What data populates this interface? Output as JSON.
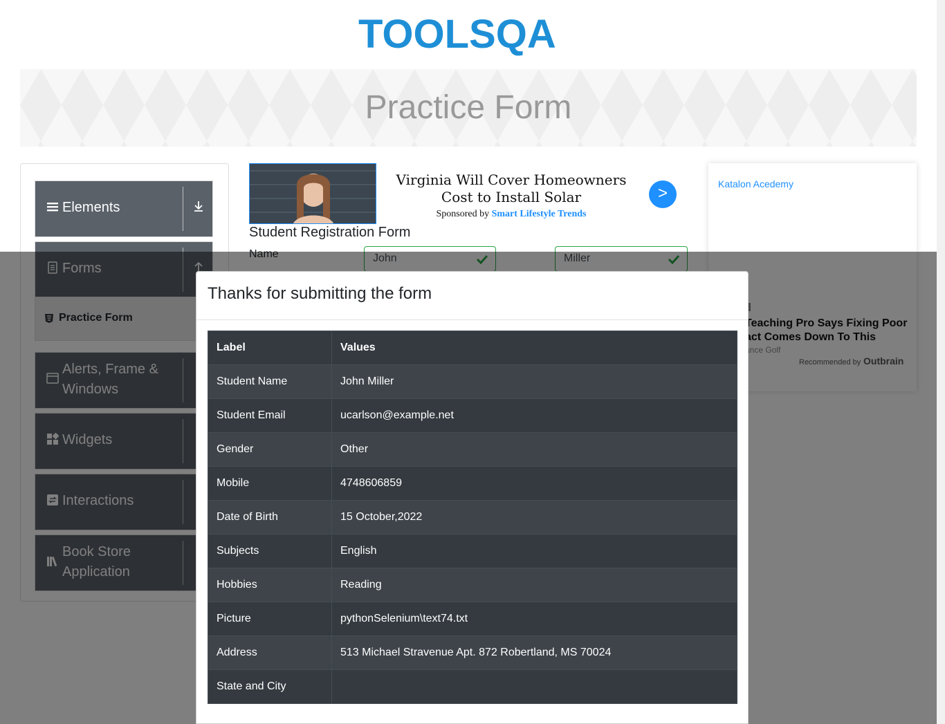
{
  "header": {
    "logo_text": "TOOLSQA"
  },
  "banner": {
    "title": "Practice Form"
  },
  "sidebar": {
    "groups": [
      {
        "label": "Elements",
        "icon": "list-icon"
      },
      {
        "label": "Forms",
        "icon": "document-icon"
      },
      {
        "label": "Alerts, Frame & Windows",
        "icon": "window-icon"
      },
      {
        "label": "Widgets",
        "icon": "widgets-icon"
      },
      {
        "label": "Interactions",
        "icon": "interactions-icon"
      },
      {
        "label": "Book Store Application",
        "icon": "books-icon"
      }
    ],
    "active_item": {
      "label": "Practice Form",
      "icon": "html5-icon"
    }
  },
  "ad": {
    "headline": "Virginia Will Cover Homeowners Cost to Install Solar",
    "sponsor_prefix": "Sponsored by",
    "sponsor_name": "Smart Lifestyle Trends",
    "go_label": ">"
  },
  "form": {
    "title": "Student Registration Form",
    "name_label": "Name",
    "first_name_value": "John",
    "last_name_value": "Miller"
  },
  "right_widget": {
    "link": "Katalon Acedemy",
    "badge": "d",
    "headline": "Teaching Pro Says Fixing Poor ...act Comes Down To This",
    "headline_line1": "Teaching Pro Says Fixing Poor",
    "headline_line2": "act Comes Down To This",
    "source": "ance Golf",
    "recommended": "Recommended by",
    "brand": "Outbrain"
  },
  "modal": {
    "title": "Thanks for submitting the form",
    "columns": [
      "Label",
      "Values"
    ],
    "rows": [
      {
        "label": "Student Name",
        "value": "John Miller"
      },
      {
        "label": "Student Email",
        "value": "ucarlson@example.net"
      },
      {
        "label": "Gender",
        "value": "Other"
      },
      {
        "label": "Mobile",
        "value": "4748606859"
      },
      {
        "label": "Date of Birth",
        "value": "15 October,2022"
      },
      {
        "label": "Subjects",
        "value": "English"
      },
      {
        "label": "Hobbies",
        "value": "Reading"
      },
      {
        "label": "Picture",
        "value": "pythonSelenium\\text74.txt"
      },
      {
        "label": "Address",
        "value": "513 Michael Stravenue Apt. 872 Robertland, MS 70024"
      },
      {
        "label": "State and City",
        "value": ""
      }
    ]
  },
  "colors": {
    "accent": "#1e90ff",
    "valid": "#28a745",
    "table_dark": "#343a40"
  }
}
